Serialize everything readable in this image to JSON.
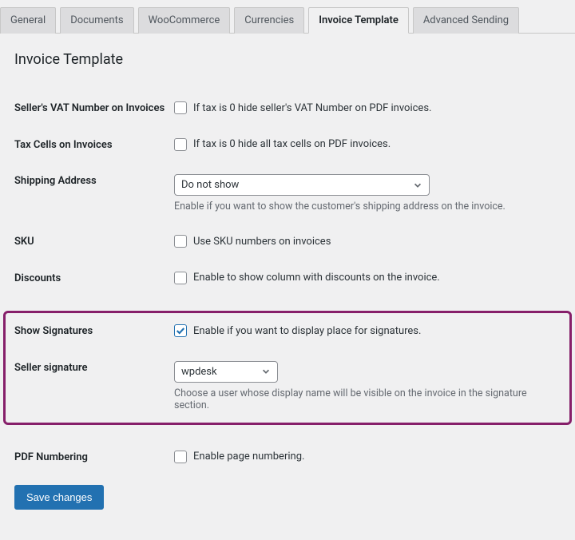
{
  "tabs": {
    "items": [
      {
        "label": "General",
        "active": false
      },
      {
        "label": "Documents",
        "active": false
      },
      {
        "label": "WooCommerce",
        "active": false
      },
      {
        "label": "Currencies",
        "active": false
      },
      {
        "label": "Invoice Template",
        "active": true
      },
      {
        "label": "Advanced Sending",
        "active": false
      }
    ]
  },
  "page_title": "Invoice Template",
  "rows": {
    "vat": {
      "heading": "Seller's VAT Number on Invoices",
      "checked": false,
      "label": "If tax is 0 hide seller's VAT Number on PDF invoices."
    },
    "tax_cells": {
      "heading": "Tax Cells on Invoices",
      "checked": false,
      "label": "If tax is 0 hide all tax cells on PDF invoices."
    },
    "shipping": {
      "heading": "Shipping Address",
      "value": "Do not show",
      "desc": "Enable if you want to show the customer's shipping address on the invoice."
    },
    "sku": {
      "heading": "SKU",
      "checked": false,
      "label": "Use SKU numbers on invoices"
    },
    "discounts": {
      "heading": "Discounts",
      "checked": false,
      "label": "Enable to show column with discounts on the invoice."
    },
    "signatures": {
      "heading": "Show Signatures",
      "checked": true,
      "label": "Enable if you want to display place for signatures."
    },
    "seller_sig": {
      "heading": "Seller signature",
      "value": "wpdesk",
      "desc": "Choose a user whose display name will be visible on the invoice in the signature section."
    },
    "pdf_num": {
      "heading": "PDF Numbering",
      "checked": false,
      "label": "Enable page numbering."
    }
  },
  "save_label": "Save changes"
}
